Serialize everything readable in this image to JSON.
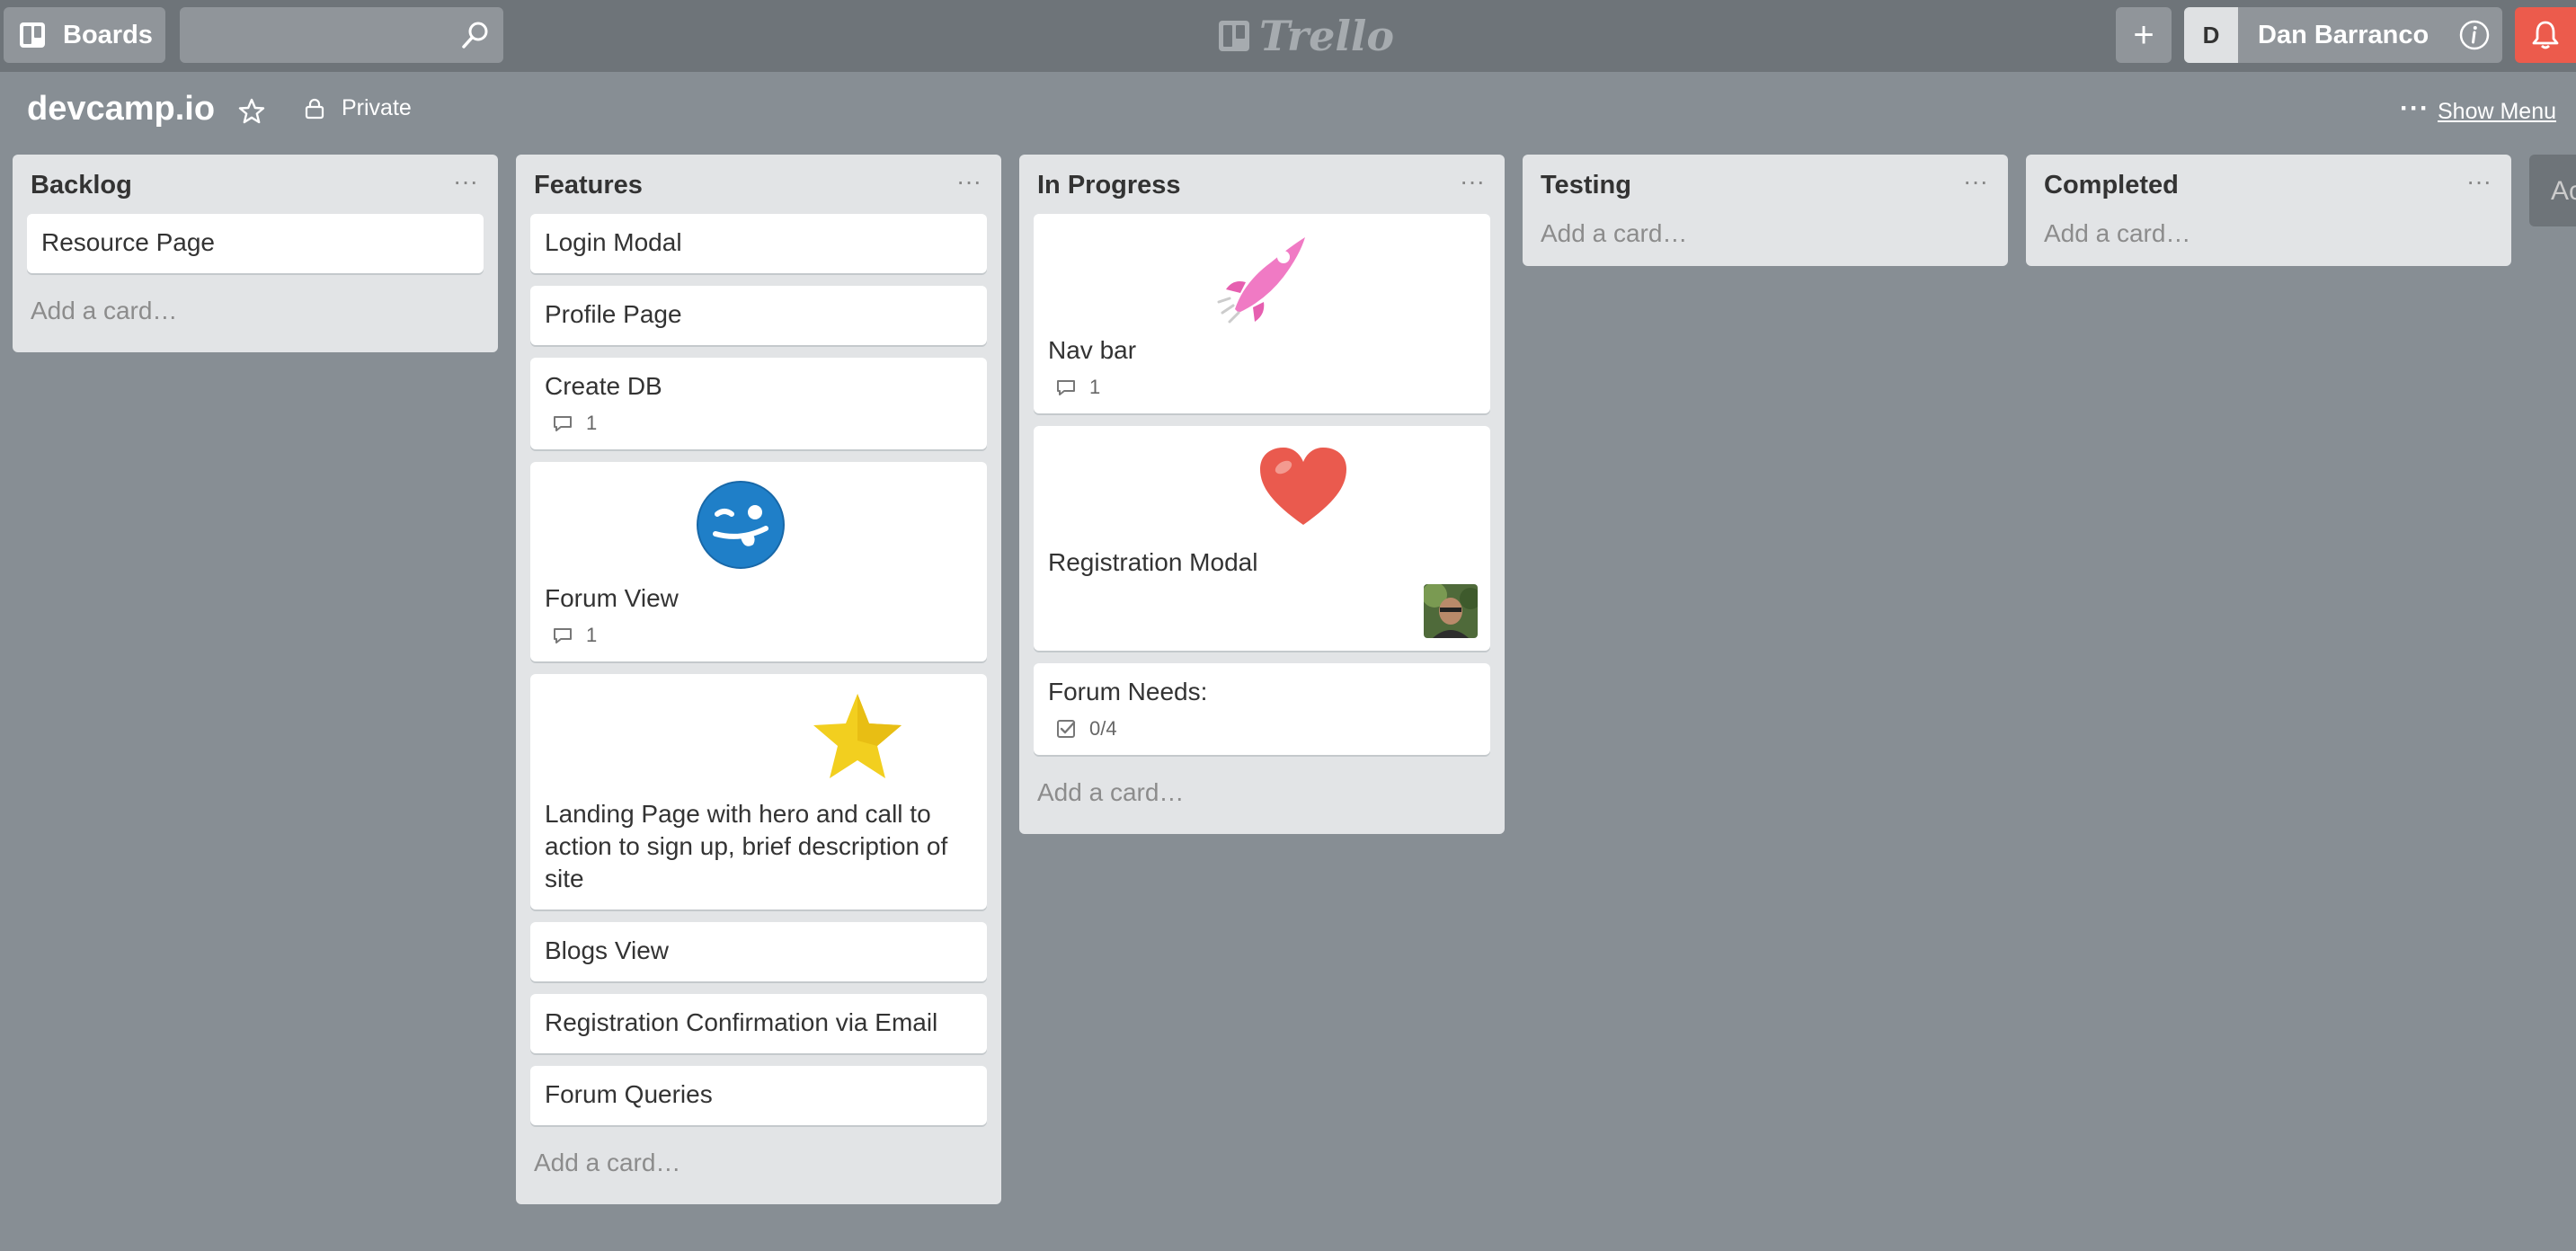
{
  "header": {
    "boards_label": "Boards",
    "search_placeholder": "",
    "logo_text": "Trello",
    "add_label": "+",
    "user_initial": "D",
    "user_name": "Dan Barranco"
  },
  "board": {
    "title": "devcamp.io",
    "visibility": "Private",
    "show_menu": "Show Menu",
    "menu_dots": "···"
  },
  "lists": [
    {
      "title": "Backlog",
      "menu": "···",
      "cards": [
        {
          "title": "Resource Page"
        }
      ],
      "add_card": "Add a card…"
    },
    {
      "title": "Features",
      "menu": "···",
      "cards": [
        {
          "title": "Login Modal"
        },
        {
          "title": "Profile Page"
        },
        {
          "title": "Create DB",
          "comments": "1"
        },
        {
          "title": "Forum View",
          "comments": "1",
          "sticker": "wink-face-sticker"
        },
        {
          "title": "Landing Page with hero and call to action to sign up, brief description of site",
          "sticker": "star-sticker"
        },
        {
          "title": "Blogs View"
        },
        {
          "title": "Registration Confirmation via Email"
        },
        {
          "title": "Forum Queries"
        }
      ],
      "add_card": "Add a card…"
    },
    {
      "title": "In Progress",
      "menu": "···",
      "cards": [
        {
          "title": "Nav bar",
          "comments": "1",
          "sticker": "rocket-sticker"
        },
        {
          "title": "Registration Modal",
          "sticker": "heart-sticker",
          "member": "member-avatar"
        },
        {
          "title": "Forum Needs:",
          "checklist": "0/4"
        }
      ],
      "add_card": "Add a card…"
    },
    {
      "title": "Testing",
      "menu": "···",
      "cards": [],
      "add_card": "Add a card…"
    },
    {
      "title": "Completed",
      "menu": "···",
      "cards": [],
      "add_card": "Add a card…"
    }
  ],
  "add_list_stub": "Ac",
  "colors": {
    "header_bg": "#6e7479",
    "board_bg": "#878e94",
    "notification_red": "#ec5b4c",
    "list_bg": "#e2e4e6"
  }
}
